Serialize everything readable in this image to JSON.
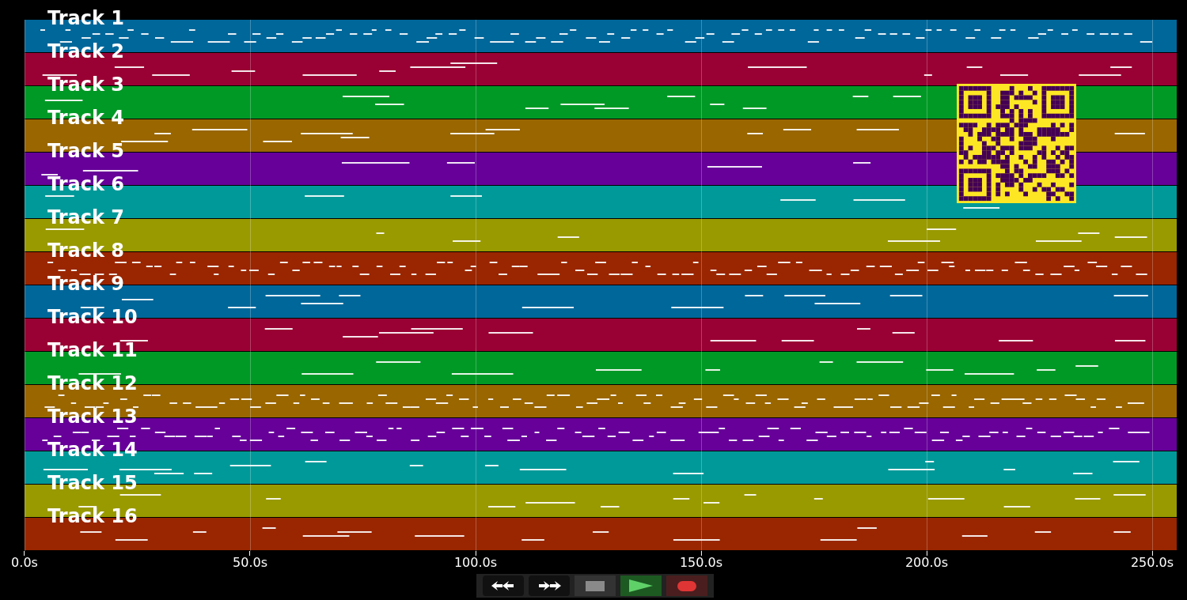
{
  "tracks": [
    {
      "name": "Track 1",
      "color": "#00679a"
    },
    {
      "name": "Track 2",
      "color": "#990033"
    },
    {
      "name": "Track 3",
      "color": "#009926"
    },
    {
      "name": "Track 4",
      "color": "#996600"
    },
    {
      "name": "Track 5",
      "color": "#660099"
    },
    {
      "name": "Track 6",
      "color": "#009999"
    },
    {
      "name": "Track 7",
      "color": "#999900"
    },
    {
      "name": "Track 8",
      "color": "#992600"
    },
    {
      "name": "Track 9",
      "color": "#00679a"
    },
    {
      "name": "Track 10",
      "color": "#990033"
    },
    {
      "name": "Track 11",
      "color": "#009926"
    },
    {
      "name": "Track 12",
      "color": "#996600"
    },
    {
      "name": "Track 13",
      "color": "#660099"
    },
    {
      "name": "Track 14",
      "color": "#009999"
    },
    {
      "name": "Track 15",
      "color": "#999900"
    },
    {
      "name": "Track 16",
      "color": "#992600"
    }
  ],
  "time_axis": {
    "ticks": [
      "0.0s",
      "50.0s",
      "100.0s",
      "150.0s",
      "200.0s",
      "250.0s"
    ]
  },
  "transport": [
    {
      "kind": "rewind"
    },
    {
      "kind": "forward"
    },
    {
      "kind": "stop"
    },
    {
      "kind": "play"
    },
    {
      "kind": "record"
    }
  ]
}
